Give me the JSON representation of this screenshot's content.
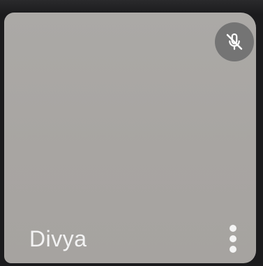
{
  "participant": {
    "name": "Divya",
    "microphone_state": "muted"
  },
  "icons": {
    "mute": "mic-off-icon",
    "more": "more-vertical-icon"
  },
  "colors": {
    "tile_background": "#a9a6a3",
    "badge_background": "#747474",
    "name_text": "#f3f3f3"
  }
}
